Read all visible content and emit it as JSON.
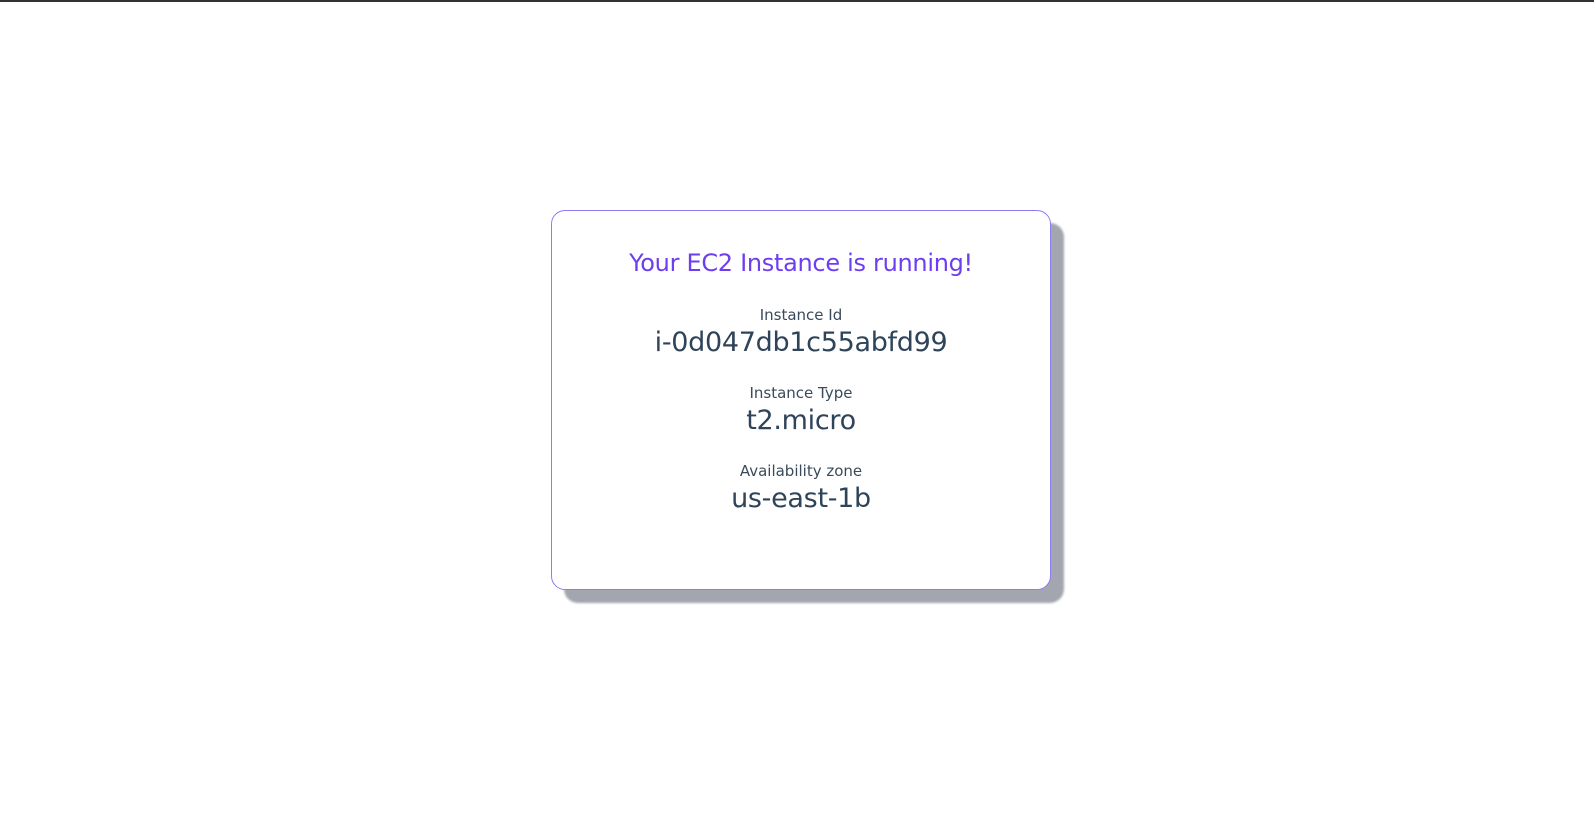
{
  "card": {
    "title": "Your EC2 Instance is running!",
    "fields": [
      {
        "label": "Instance Id",
        "value": "i-0d047db1c55abfd99"
      },
      {
        "label": "Instance Type",
        "value": "t2.micro"
      },
      {
        "label": "Availability zone",
        "value": "us-east-1b"
      }
    ]
  },
  "colors": {
    "title": "#6d3ef0",
    "card_border": "#8f7cf2",
    "text": "#2f4459",
    "shadow": "#a3a6ae"
  }
}
